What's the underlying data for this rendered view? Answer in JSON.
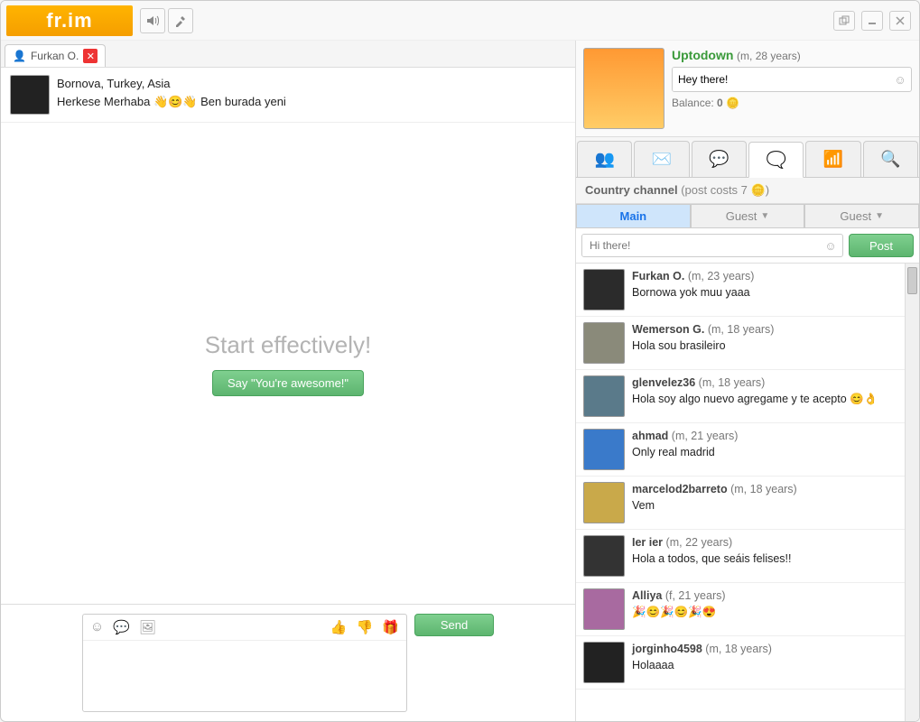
{
  "app": {
    "logo": "fr.im"
  },
  "tab": {
    "title": "Furkan O."
  },
  "convo": {
    "location": "Bornova, Turkey, Asia",
    "greeting_pre": "Herkese Merhaba ",
    "greeting_post": " Ben burada yeni"
  },
  "prompt": {
    "headline": "Start effectively!",
    "button": "Say \"You're awesome!\""
  },
  "send_label": "Send",
  "profile": {
    "name": "Uptodown",
    "meta": "(m, 28 years)",
    "status": "Hey there!",
    "balance_label": "Balance:",
    "balance_value": "0"
  },
  "channel": {
    "label_bold": "Country channel",
    "label_rest": "(post costs 7",
    "label_end": ")"
  },
  "subtabs": [
    "Main",
    "Guest",
    "Guest"
  ],
  "postbox": {
    "placeholder": "Hi there!",
    "button": "Post"
  },
  "feed": [
    {
      "name": "Furkan O.",
      "meta": "(m, 23 years)",
      "msg": "Bornowa yok muu yaaa",
      "avatar": "#2b2b2b"
    },
    {
      "name": "Wemerson G.",
      "meta": "(m, 18 years)",
      "msg": "Hola sou brasileiro",
      "avatar": "#8a8a7a"
    },
    {
      "name": "glenvelez36",
      "meta": "(m, 18 years)",
      "msg": "Hola soy algo nuevo agregame y te acepto 😊👌",
      "avatar": "#5a7a8a"
    },
    {
      "name": "ahmad",
      "meta": "(m, 21 years)",
      "msg": "Only real madrid",
      "avatar": "#3a7aca"
    },
    {
      "name": "marcelod2barreto",
      "meta": "(m, 18 years)",
      "msg": "Vem",
      "avatar": "#c9a94a"
    },
    {
      "name": "Ier ier",
      "meta": "(m, 22 years)",
      "msg": "Hola a todos, que seáis felises!!",
      "avatar": "#333"
    },
    {
      "name": "Alliya",
      "meta": "(f, 21 years)",
      "msg": "🎉😊🎉😊🎉😍",
      "avatar": "#a86aa0"
    },
    {
      "name": "jorginho4598",
      "meta": "(m, 18 years)",
      "msg": "Holaaaa",
      "avatar": "#222"
    }
  ]
}
